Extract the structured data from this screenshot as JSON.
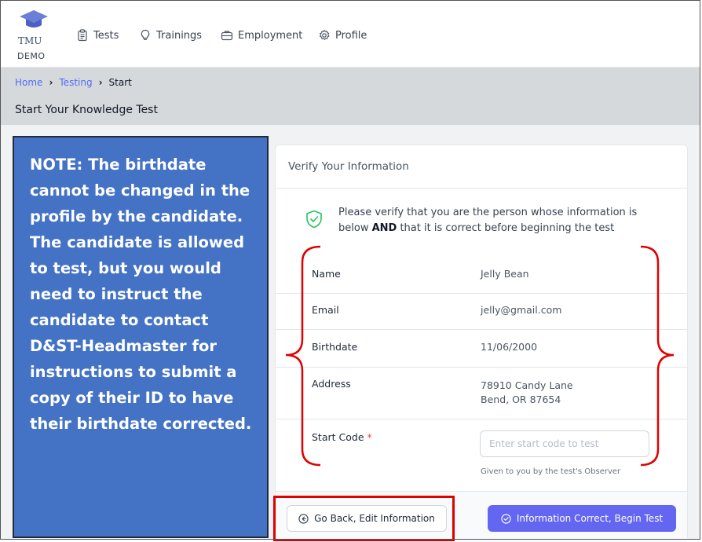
{
  "nav": {
    "logo_text": "TMU",
    "logo_sub": "DEMO",
    "items": [
      {
        "label": "Tests",
        "icon": "clipboard-icon"
      },
      {
        "label": "Trainings",
        "icon": "lightbulb-icon"
      },
      {
        "label": "Employment",
        "icon": "briefcase-icon"
      },
      {
        "label": "Profile",
        "icon": "gear-icon"
      }
    ]
  },
  "breadcrumb": {
    "home": "Home",
    "testing": "Testing",
    "current": "Start",
    "separator": "›"
  },
  "page_title": "Start Your Knowledge Test",
  "note": "NOTE: The birthdate cannot be changed in the profile by the candidate.  The candidate is allowed to test, but you would need to instruct the candidate to contact D&ST-Headmaster for instructions to submit a copy of their ID to have their birthdate corrected.",
  "card": {
    "title": "Verify Your Information",
    "verify_text_before": "Please verify that you are the person whose information is below ",
    "verify_text_bold": "AND",
    "verify_text_after": " that it is correct before beginning the test",
    "fields": {
      "name_label": "Name",
      "name_value": "Jelly Bean",
      "email_label": "Email",
      "email_value": "jelly@gmail.com",
      "birthdate_label": "Birthdate",
      "birthdate_value": "11/06/2000",
      "address_label": "Address",
      "address_line1": "78910 Candy Lane",
      "address_line2": "Bend, OR 87654",
      "start_code_label": "Start Code",
      "required_mark": "*",
      "start_code_placeholder": "Enter start code to test",
      "start_code_hint": "Given to you by the test's Observer"
    },
    "back_button": "Go Back, Edit Information",
    "begin_button": "Information Correct, Begin Test"
  },
  "colors": {
    "primary": "#6366f1",
    "link": "#4f6df5",
    "note_bg": "#4472c4",
    "annotation_red": "#e00000",
    "shield_green": "#22c55e"
  }
}
